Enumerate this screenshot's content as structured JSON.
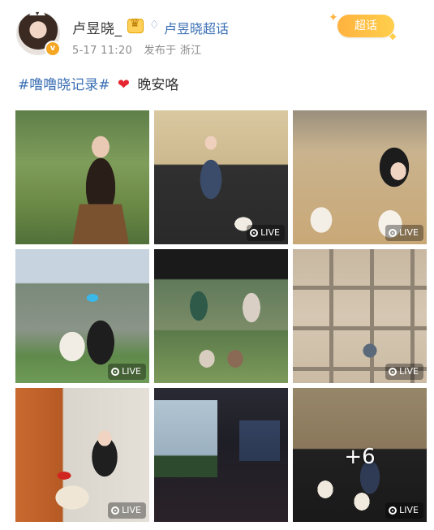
{
  "header": {
    "username": "卢昱晓_",
    "supertopic_link": "卢昱晓超话",
    "date": "5-17 11:20",
    "source": "发布于 浙江",
    "badge_label": "超话"
  },
  "post": {
    "hashtag": "#噜噜晓记录#",
    "body": "晚安咯"
  },
  "grid": {
    "live_label": "LIVE",
    "more_count": "+6",
    "cells": [
      {
        "desc": "girl-sitting-garden",
        "live": false
      },
      {
        "desc": "girl-on-stairs-with-dog",
        "live": true
      },
      {
        "desc": "girl-with-dog-closeup",
        "live": true
      },
      {
        "desc": "girl-cap-with-dog-mountain",
        "live": true
      },
      {
        "desc": "tv-drama-collage",
        "live": false
      },
      {
        "desc": "ceiling-mirror-shot",
        "live": true
      },
      {
        "desc": "girl-holding-dog-sunglasses",
        "live": true
      },
      {
        "desc": "dark-window-sky",
        "live": false
      },
      {
        "desc": "girl-stairs-two-dogs",
        "live": true
      }
    ]
  },
  "colors": {
    "link": "#3b6fb4",
    "meta": "#8b8b8b",
    "badge": "#ffb23f",
    "heart": "#e5262f"
  }
}
